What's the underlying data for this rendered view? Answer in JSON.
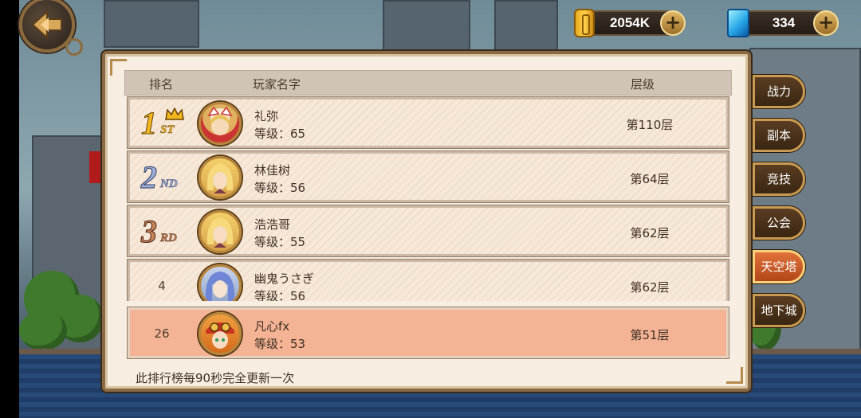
{
  "currency": {
    "gold": {
      "value": "2054K",
      "icon": "gold-bar-icon"
    },
    "gems": {
      "value": "334",
      "icon": "blue-gem-icon"
    },
    "plus_label": "+"
  },
  "table": {
    "headers": {
      "rank": "排名",
      "player_name": "玩家名字",
      "floor": "层级"
    },
    "rows": [
      {
        "rank": "1",
        "badge_main": "1",
        "badge_suffix": "ST",
        "name": "礼弥",
        "level": "等级：65",
        "floor": "第110层",
        "avatar": "avatar-cat-girl"
      },
      {
        "rank": "2",
        "badge_main": "2",
        "badge_suffix": "ND",
        "name": "林佳树",
        "level": "等级：56",
        "floor": "第64层",
        "avatar": "avatar-blonde-knight"
      },
      {
        "rank": "3",
        "badge_main": "3",
        "badge_suffix": "RD",
        "name": "浩浩哥",
        "level": "等级：55",
        "floor": "第62层",
        "avatar": "avatar-blonde-knight"
      },
      {
        "rank": "4",
        "name": "幽鬼うさぎ",
        "level": "等级：56",
        "floor": "第62层",
        "avatar": "avatar-blue-hair-girl"
      }
    ],
    "my_rank": {
      "rank": "26",
      "name": "凡心fx",
      "level": "等级：53",
      "floor": "第51层",
      "avatar": "avatar-goggles-girl"
    },
    "footer_note": "此排行榜每90秒完全更新一次"
  },
  "tabs": [
    {
      "label": "战力",
      "active": false
    },
    {
      "label": "副本",
      "active": false
    },
    {
      "label": "竞技",
      "active": false
    },
    {
      "label": "公会",
      "active": false
    },
    {
      "label": "天空塔",
      "active": true
    },
    {
      "label": "地下城",
      "active": false
    }
  ],
  "colors": {
    "panel_bg": "#f7ede0",
    "my_row_bg": "#f4b394",
    "gold_badge": "#f0b81e",
    "silver_badge": "#8ea0c8",
    "bronze_badge": "#c78458",
    "active_tab": "#e0733a"
  }
}
